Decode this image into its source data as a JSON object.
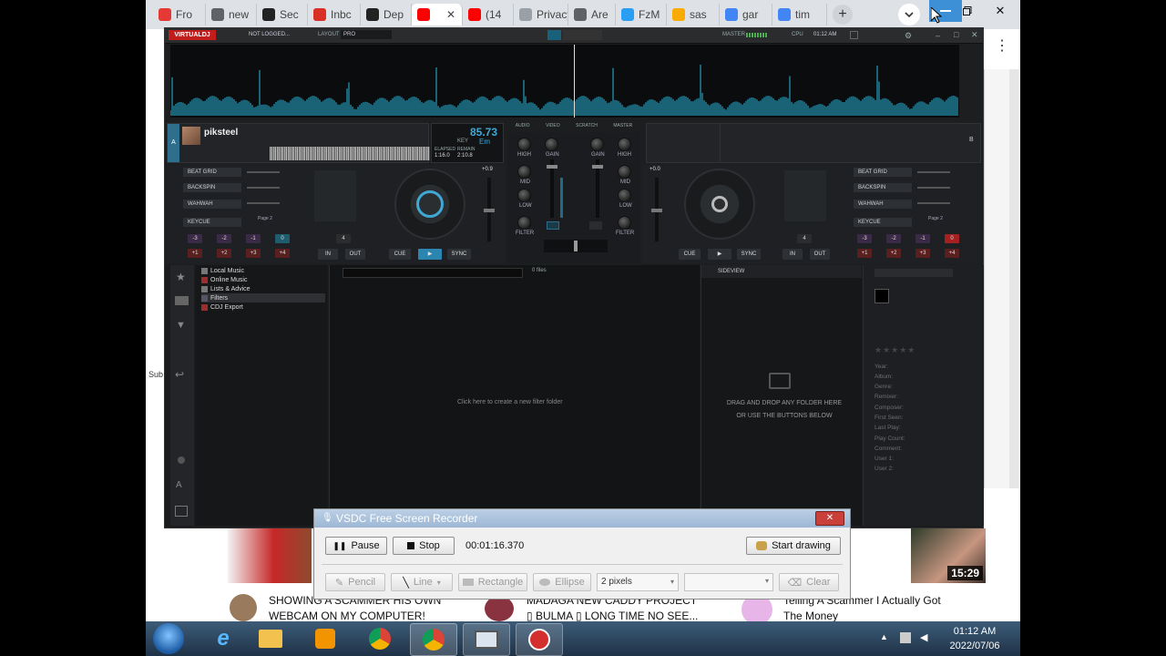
{
  "chrome": {
    "tabs": [
      {
        "label": "Fro",
        "color": "#e53935"
      },
      {
        "label": "new",
        "color": "#5f6368"
      },
      {
        "label": "Sec",
        "color": "#222222"
      },
      {
        "label": "Inbc",
        "color": "#d93025"
      },
      {
        "label": "Dep",
        "color": "#222222"
      },
      {
        "label": "",
        "color": "#ff0000"
      },
      {
        "label": "(14",
        "color": "#ff0000"
      },
      {
        "label": "Privacy",
        "color": "#9aa0a6"
      },
      {
        "label": "Are",
        "color": "#5f6368"
      },
      {
        "label": "FzM",
        "color": "#2a9df4"
      },
      {
        "label": "sas",
        "color": "#f9ab00"
      },
      {
        "label": "gar",
        "color": "#4285f4"
      },
      {
        "label": "tim",
        "color": "#4285f4"
      }
    ],
    "new_tab_symbol": "+",
    "close_symbol": "✕"
  },
  "vdj": {
    "logo": "VIRTUALDJ",
    "login": "NOT LOGGED...",
    "layout_label": "LAYOUT",
    "layout_value": "PRO",
    "master_label": "MASTER",
    "cpu_label": "CPU",
    "clock": "01:12 AM",
    "deck_a": {
      "letter": "A",
      "track": "piksteel",
      "bpm": "85.73",
      "key": "Em",
      "key_label": "KEY",
      "elapsed_label": "ELAPSED",
      "remain_label": "REMAIN",
      "elapsed": "1:16.0",
      "remain": "2:10.8",
      "pitch": "+0.9",
      "fx": [
        "BEAT GRID",
        "BACKSPIN",
        "WAHWAH"
      ],
      "keycue": "KEYCUE",
      "pad_page": "Page 2",
      "pads_top": [
        "-3",
        "-2",
        "-1",
        "0"
      ],
      "pads_bottom": [
        "+1",
        "+2",
        "+3",
        "+4"
      ],
      "loop_value": "4",
      "in": "IN",
      "out": "OUT",
      "cue": "CUE",
      "play": "▶",
      "sync": "SYNC"
    },
    "deck_b": {
      "letter": "B",
      "pitch": "+0.0",
      "fx": [
        "BEAT GRID",
        "BACKSPIN",
        "WAHWAH"
      ],
      "keycue": "KEYCUE",
      "pad_page": "Page 2",
      "pads_top": [
        "-3",
        "-2",
        "-1",
        "0"
      ],
      "pads_bottom": [
        "+1",
        "+2",
        "+3",
        "+4"
      ],
      "loop_value": "4",
      "in": "IN",
      "out": "OUT",
      "cue": "CUE",
      "play": "▶",
      "sync": "SYNC"
    },
    "mixer": {
      "tabs": [
        "AUDIO",
        "VIDEO",
        "SCRATCH",
        "MASTER"
      ],
      "labels_left": [
        "HIGH",
        "MID",
        "LOW",
        "FILTER"
      ],
      "labels_right": [
        "HIGH",
        "MID",
        "LOW",
        "FILTER"
      ],
      "gain": "GAIN"
    },
    "browser": {
      "tree": [
        "Local Music",
        "Online Music",
        "Lists & Advice",
        "Filters",
        "CDJ Export"
      ],
      "file_count": "0 files",
      "empty_hint": "Click here to create a new filter folder",
      "sideview_title": "SIDEVIEW",
      "sideview_hint1": "DRAG AND DROP ANY FOLDER HERE",
      "sideview_hint2": "OR USE THE BUTTONS BELOW",
      "meta_fields": [
        "Year:",
        "Album:",
        "Genre:",
        "Remixer:",
        "Composer:",
        "First Seen:",
        "Last Play:",
        "Play Count:",
        "Comment:",
        "User 1:",
        "User 2:"
      ]
    }
  },
  "recorder": {
    "title": "VSDC Free Screen Recorder",
    "pause": "Pause",
    "stop": "Stop",
    "timer": "00:01:16.370",
    "start_drawing": "Start drawing",
    "pencil": "Pencil",
    "line": "Line",
    "rectangle": "Rectangle",
    "ellipse": "Ellipse",
    "thickness": "2 pixels",
    "clear": "Clear"
  },
  "youtube": {
    "video1": [
      "SHOWING A SCAMMER HIS OWN",
      "WEBCAM ON MY COMPUTER!"
    ],
    "video2": [
      "MADAGA NEW CADDY PROJECT",
      "▯ BULMA ▯ LONG TIME NO SEE..."
    ],
    "video3": [
      "Telling A Scammer I Actually Got",
      "The Money"
    ],
    "duration": "15:29",
    "side_text": "Sub"
  },
  "taskbar": {
    "time": "01:12 AM",
    "date": "2022/07/06"
  }
}
